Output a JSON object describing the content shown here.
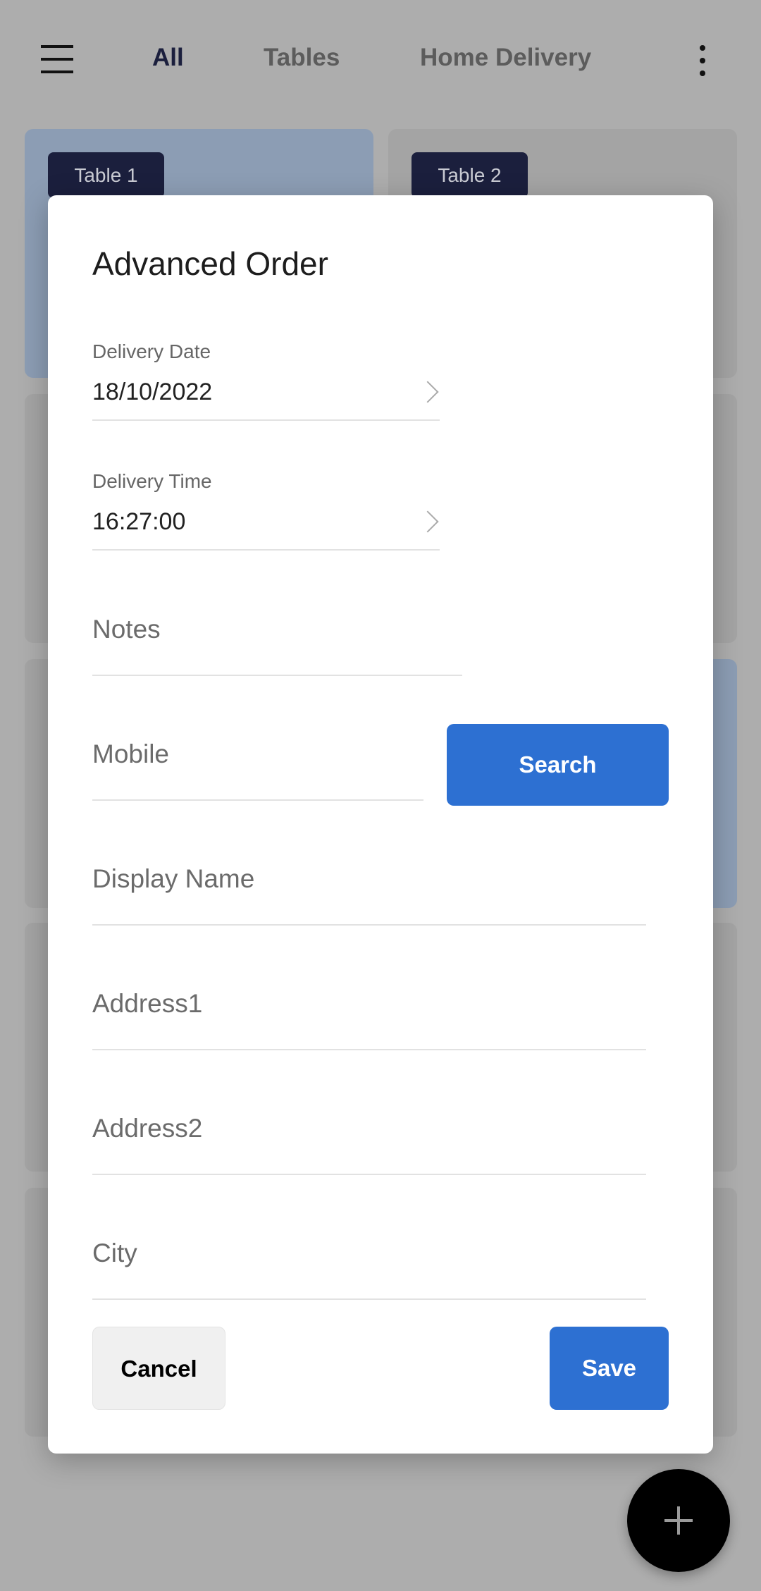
{
  "header": {
    "menu_icon": "hamburger-icon",
    "tabs": [
      {
        "label": "All",
        "active": true
      },
      {
        "label": "Tables"
      },
      {
        "label": "Home Delivery"
      }
    ],
    "more_icon": "kebab-icon"
  },
  "tables": [
    {
      "label": "Table 1",
      "selected": true
    },
    {
      "label": "Table 2"
    }
  ],
  "modal": {
    "title": "Advanced Order",
    "delivery_date": {
      "label": "Delivery Date",
      "value": "18/10/2022"
    },
    "delivery_time": {
      "label": "Delivery Time",
      "value": "16:27:00"
    },
    "notes": {
      "placeholder": "Notes"
    },
    "mobile": {
      "placeholder": "Mobile"
    },
    "search_label": "Search",
    "display_name": {
      "placeholder": "Display Name"
    },
    "address1": {
      "placeholder": "Address1"
    },
    "address2": {
      "placeholder": "Address2"
    },
    "city": {
      "placeholder": "City"
    },
    "cancel_label": "Cancel",
    "save_label": "Save"
  },
  "fab_icon": "plus-icon",
  "colors": {
    "accent": "#2d70d2",
    "badge": "#1b1f3d"
  }
}
